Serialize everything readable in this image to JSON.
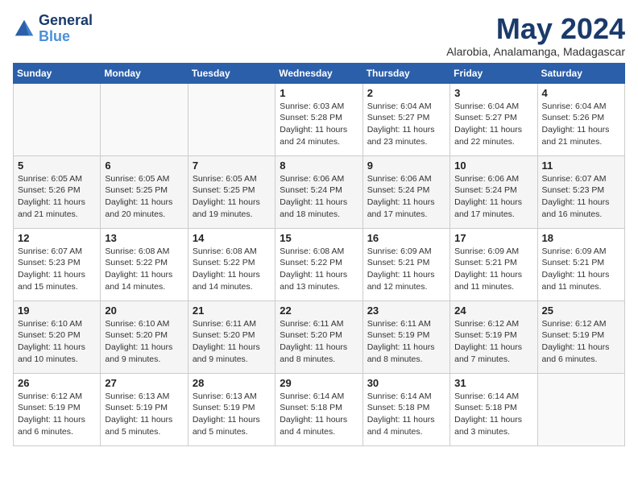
{
  "header": {
    "logo_line1": "General",
    "logo_line2": "Blue",
    "month_title": "May 2024",
    "location": "Alarobia, Analamanga, Madagascar"
  },
  "days_of_week": [
    "Sunday",
    "Monday",
    "Tuesday",
    "Wednesday",
    "Thursday",
    "Friday",
    "Saturday"
  ],
  "weeks": [
    [
      {
        "day": "",
        "info": ""
      },
      {
        "day": "",
        "info": ""
      },
      {
        "day": "",
        "info": ""
      },
      {
        "day": "1",
        "info": "Sunrise: 6:03 AM\nSunset: 5:28 PM\nDaylight: 11 hours\nand 24 minutes."
      },
      {
        "day": "2",
        "info": "Sunrise: 6:04 AM\nSunset: 5:27 PM\nDaylight: 11 hours\nand 23 minutes."
      },
      {
        "day": "3",
        "info": "Sunrise: 6:04 AM\nSunset: 5:27 PM\nDaylight: 11 hours\nand 22 minutes."
      },
      {
        "day": "4",
        "info": "Sunrise: 6:04 AM\nSunset: 5:26 PM\nDaylight: 11 hours\nand 21 minutes."
      }
    ],
    [
      {
        "day": "5",
        "info": "Sunrise: 6:05 AM\nSunset: 5:26 PM\nDaylight: 11 hours\nand 21 minutes."
      },
      {
        "day": "6",
        "info": "Sunrise: 6:05 AM\nSunset: 5:25 PM\nDaylight: 11 hours\nand 20 minutes."
      },
      {
        "day": "7",
        "info": "Sunrise: 6:05 AM\nSunset: 5:25 PM\nDaylight: 11 hours\nand 19 minutes."
      },
      {
        "day": "8",
        "info": "Sunrise: 6:06 AM\nSunset: 5:24 PM\nDaylight: 11 hours\nand 18 minutes."
      },
      {
        "day": "9",
        "info": "Sunrise: 6:06 AM\nSunset: 5:24 PM\nDaylight: 11 hours\nand 17 minutes."
      },
      {
        "day": "10",
        "info": "Sunrise: 6:06 AM\nSunset: 5:24 PM\nDaylight: 11 hours\nand 17 minutes."
      },
      {
        "day": "11",
        "info": "Sunrise: 6:07 AM\nSunset: 5:23 PM\nDaylight: 11 hours\nand 16 minutes."
      }
    ],
    [
      {
        "day": "12",
        "info": "Sunrise: 6:07 AM\nSunset: 5:23 PM\nDaylight: 11 hours\nand 15 minutes."
      },
      {
        "day": "13",
        "info": "Sunrise: 6:08 AM\nSunset: 5:22 PM\nDaylight: 11 hours\nand 14 minutes."
      },
      {
        "day": "14",
        "info": "Sunrise: 6:08 AM\nSunset: 5:22 PM\nDaylight: 11 hours\nand 14 minutes."
      },
      {
        "day": "15",
        "info": "Sunrise: 6:08 AM\nSunset: 5:22 PM\nDaylight: 11 hours\nand 13 minutes."
      },
      {
        "day": "16",
        "info": "Sunrise: 6:09 AM\nSunset: 5:21 PM\nDaylight: 11 hours\nand 12 minutes."
      },
      {
        "day": "17",
        "info": "Sunrise: 6:09 AM\nSunset: 5:21 PM\nDaylight: 11 hours\nand 11 minutes."
      },
      {
        "day": "18",
        "info": "Sunrise: 6:09 AM\nSunset: 5:21 PM\nDaylight: 11 hours\nand 11 minutes."
      }
    ],
    [
      {
        "day": "19",
        "info": "Sunrise: 6:10 AM\nSunset: 5:20 PM\nDaylight: 11 hours\nand 10 minutes."
      },
      {
        "day": "20",
        "info": "Sunrise: 6:10 AM\nSunset: 5:20 PM\nDaylight: 11 hours\nand 9 minutes."
      },
      {
        "day": "21",
        "info": "Sunrise: 6:11 AM\nSunset: 5:20 PM\nDaylight: 11 hours\nand 9 minutes."
      },
      {
        "day": "22",
        "info": "Sunrise: 6:11 AM\nSunset: 5:20 PM\nDaylight: 11 hours\nand 8 minutes."
      },
      {
        "day": "23",
        "info": "Sunrise: 6:11 AM\nSunset: 5:19 PM\nDaylight: 11 hours\nand 8 minutes."
      },
      {
        "day": "24",
        "info": "Sunrise: 6:12 AM\nSunset: 5:19 PM\nDaylight: 11 hours\nand 7 minutes."
      },
      {
        "day": "25",
        "info": "Sunrise: 6:12 AM\nSunset: 5:19 PM\nDaylight: 11 hours\nand 6 minutes."
      }
    ],
    [
      {
        "day": "26",
        "info": "Sunrise: 6:12 AM\nSunset: 5:19 PM\nDaylight: 11 hours\nand 6 minutes."
      },
      {
        "day": "27",
        "info": "Sunrise: 6:13 AM\nSunset: 5:19 PM\nDaylight: 11 hours\nand 5 minutes."
      },
      {
        "day": "28",
        "info": "Sunrise: 6:13 AM\nSunset: 5:19 PM\nDaylight: 11 hours\nand 5 minutes."
      },
      {
        "day": "29",
        "info": "Sunrise: 6:14 AM\nSunset: 5:18 PM\nDaylight: 11 hours\nand 4 minutes."
      },
      {
        "day": "30",
        "info": "Sunrise: 6:14 AM\nSunset: 5:18 PM\nDaylight: 11 hours\nand 4 minutes."
      },
      {
        "day": "31",
        "info": "Sunrise: 6:14 AM\nSunset: 5:18 PM\nDaylight: 11 hours\nand 3 minutes."
      },
      {
        "day": "",
        "info": ""
      }
    ]
  ]
}
